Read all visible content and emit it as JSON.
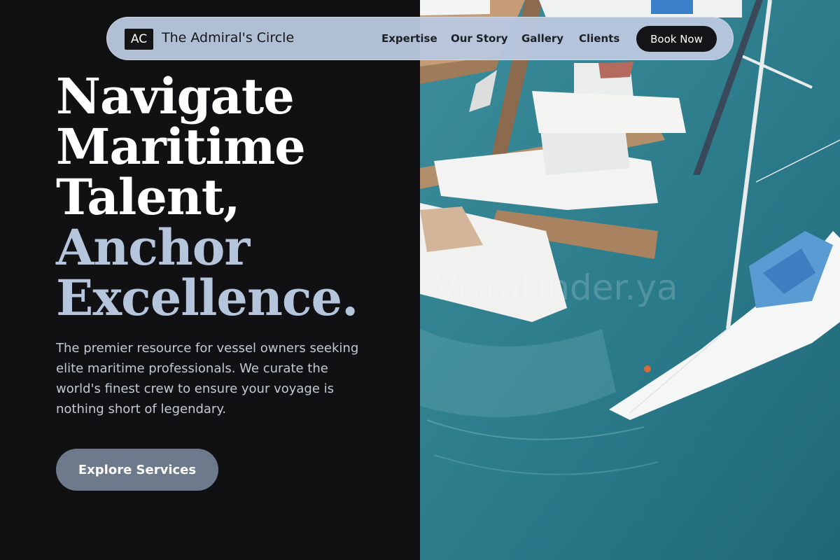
{
  "nav": {
    "logo_mark": "AC",
    "brand": "The Admiral's Circle",
    "links": [
      "Expertise",
      "Our Story",
      "Gallery",
      "Clients"
    ],
    "cta": "Book Now"
  },
  "hero": {
    "headline_white": [
      "Navigate",
      "Maritime",
      "Talent,"
    ],
    "headline_accent": [
      "Anchor",
      "Excellence."
    ],
    "intro": "The premier resource for vessel owners seeking elite maritime professionals. We curate the world's finest crew to ensure your voyage is nothing short of legendary.",
    "cta": "Explore Services"
  },
  "image": {
    "subject": "marina-aerial-photo",
    "watermark": "VistaFinder.ya"
  },
  "colors": {
    "background": "#111113",
    "accent_text": "#b4c5dc",
    "nav_bg": "#b8c7de",
    "cta_bg": "#6c7a8c",
    "water": "#2e7f8f"
  }
}
